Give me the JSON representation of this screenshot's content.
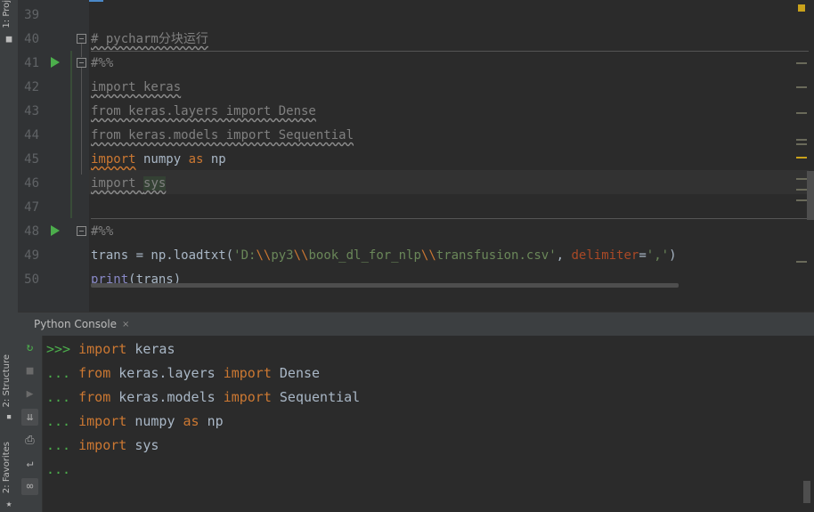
{
  "side_labels": {
    "project": "1: Proj",
    "structure": "2: Structure",
    "favorites": "2: Favorites"
  },
  "editor": {
    "lines": [
      {
        "n": "39"
      },
      {
        "n": "40",
        "t1": "# pycharm分块运行"
      },
      {
        "n": "41",
        "t1": "#%%"
      },
      {
        "n": "42",
        "t1": "import keras"
      },
      {
        "n": "43",
        "t1": "from keras.layers import Dense"
      },
      {
        "n": "44",
        "t1": "from keras.models import Sequential"
      },
      {
        "n": "45",
        "kw1": "import",
        "t1": " numpy ",
        "kw2": "as",
        "t2": " np"
      },
      {
        "n": "46",
        "t1": "import ",
        "t2": "sys"
      },
      {
        "n": "47"
      },
      {
        "n": "48",
        "t1": "#%%"
      },
      {
        "n": "49",
        "a": "trans = np.loadtxt(",
        "s1": "'D:",
        "e1": "\\\\",
        "s2": "py3",
        "e2": "\\\\",
        "s3": "book_dl_for_nlp",
        "e3": "\\\\",
        "s4": "transfusion.csv'",
        "b": ", ",
        "p": "delimiter",
        "c": "=",
        "s5": "','",
        "d": ")"
      },
      {
        "n": "50",
        "f": "print",
        "g": "(trans)"
      }
    ]
  },
  "console": {
    "tab_label": "Python Console",
    "tab_close": "×",
    "prompt_first": ">>>",
    "prompt_cont": "...",
    "lines": [
      {
        "kw1": "import",
        "t1": " keras"
      },
      {
        "kw1": "from",
        "t1": " keras.layers ",
        "kw2": "import",
        "t2": " Dense"
      },
      {
        "kw1": "from",
        "t1": " keras.models ",
        "kw2": "import",
        "t2": " Sequential"
      },
      {
        "kw1": "import",
        "t1": " numpy ",
        "kw2": "as",
        "t2": " np"
      },
      {
        "kw1": "import",
        "t1": " sys"
      }
    ]
  },
  "colors": {
    "keyword": "#cc7832",
    "string": "#6a8759",
    "comment": "#808080",
    "text": "#a9b7c6",
    "run_green": "#4cae4c"
  },
  "icons": {
    "run": "play-triangle",
    "rerun": "rerun-icon",
    "stop": "stop-icon",
    "execute": "execute-icon",
    "scroll_end": "scroll-to-end-icon",
    "print": "print-icon",
    "soft_wrap": "soft-wrap-icon",
    "show_vars": "show-variables-icon"
  }
}
